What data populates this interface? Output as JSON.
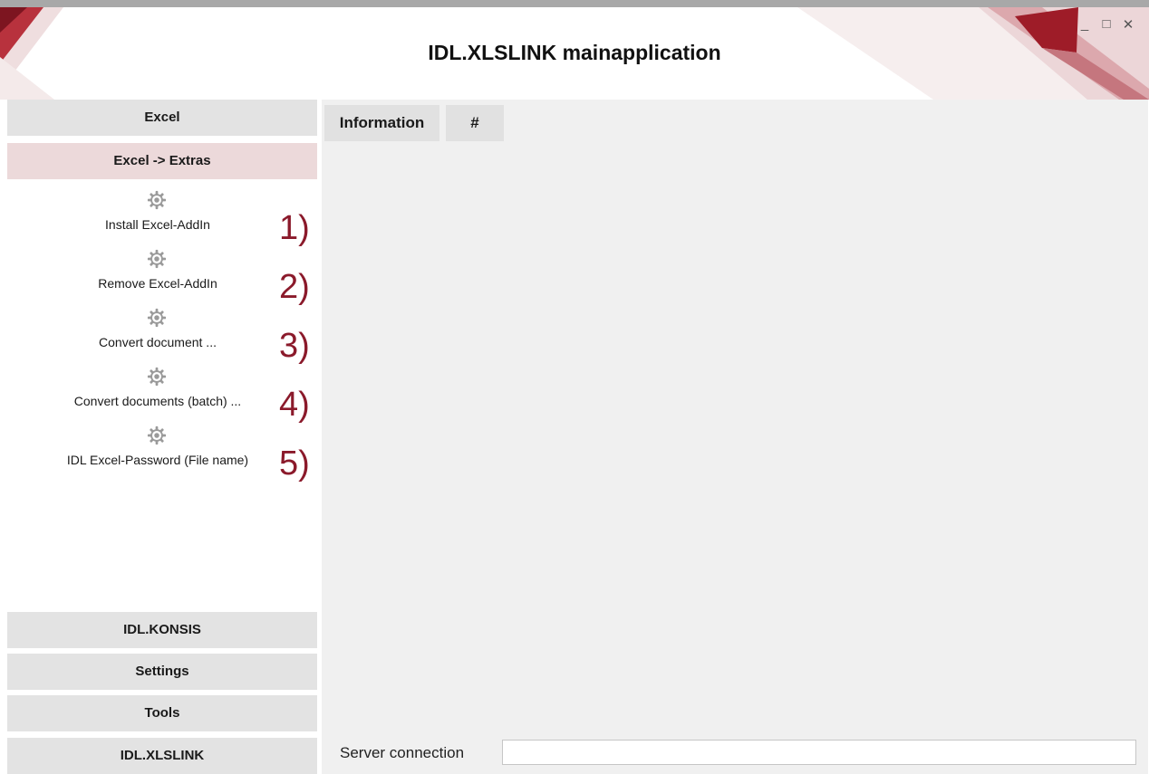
{
  "window": {
    "title": "IDL.XLSLINK mainapplication",
    "controls": {
      "minimize": "_",
      "maximize": "□",
      "close": "✕"
    }
  },
  "sidebar": {
    "top_button": "Excel",
    "active_section": "Excel -> Extras",
    "items": [
      {
        "label": "Install Excel-AddIn",
        "marker": "1)",
        "icon": "gear-icon"
      },
      {
        "label": "Remove Excel-AddIn",
        "marker": "2)",
        "icon": "gear-icon"
      },
      {
        "label": "Convert document ...",
        "marker": "3)",
        "icon": "gear-icon"
      },
      {
        "label": "Convert documents (batch) ...",
        "marker": "4)",
        "icon": "gear-icon"
      },
      {
        "label": "IDL Excel-Password (File name)",
        "marker": "5)",
        "icon": "gear-icon"
      }
    ],
    "bottom_buttons": [
      "IDL.KONSIS",
      "Settings",
      "Tools",
      "IDL.XLSLINK"
    ]
  },
  "main": {
    "tabs": [
      "Information",
      "#"
    ]
  },
  "status": {
    "label": "Server connection",
    "value": ""
  },
  "colors": {
    "accent": "#8b1a2b",
    "active_section_bg": "#ecd9da",
    "button_bg": "#e3e3e3",
    "panel_bg": "#f0f0f0"
  }
}
